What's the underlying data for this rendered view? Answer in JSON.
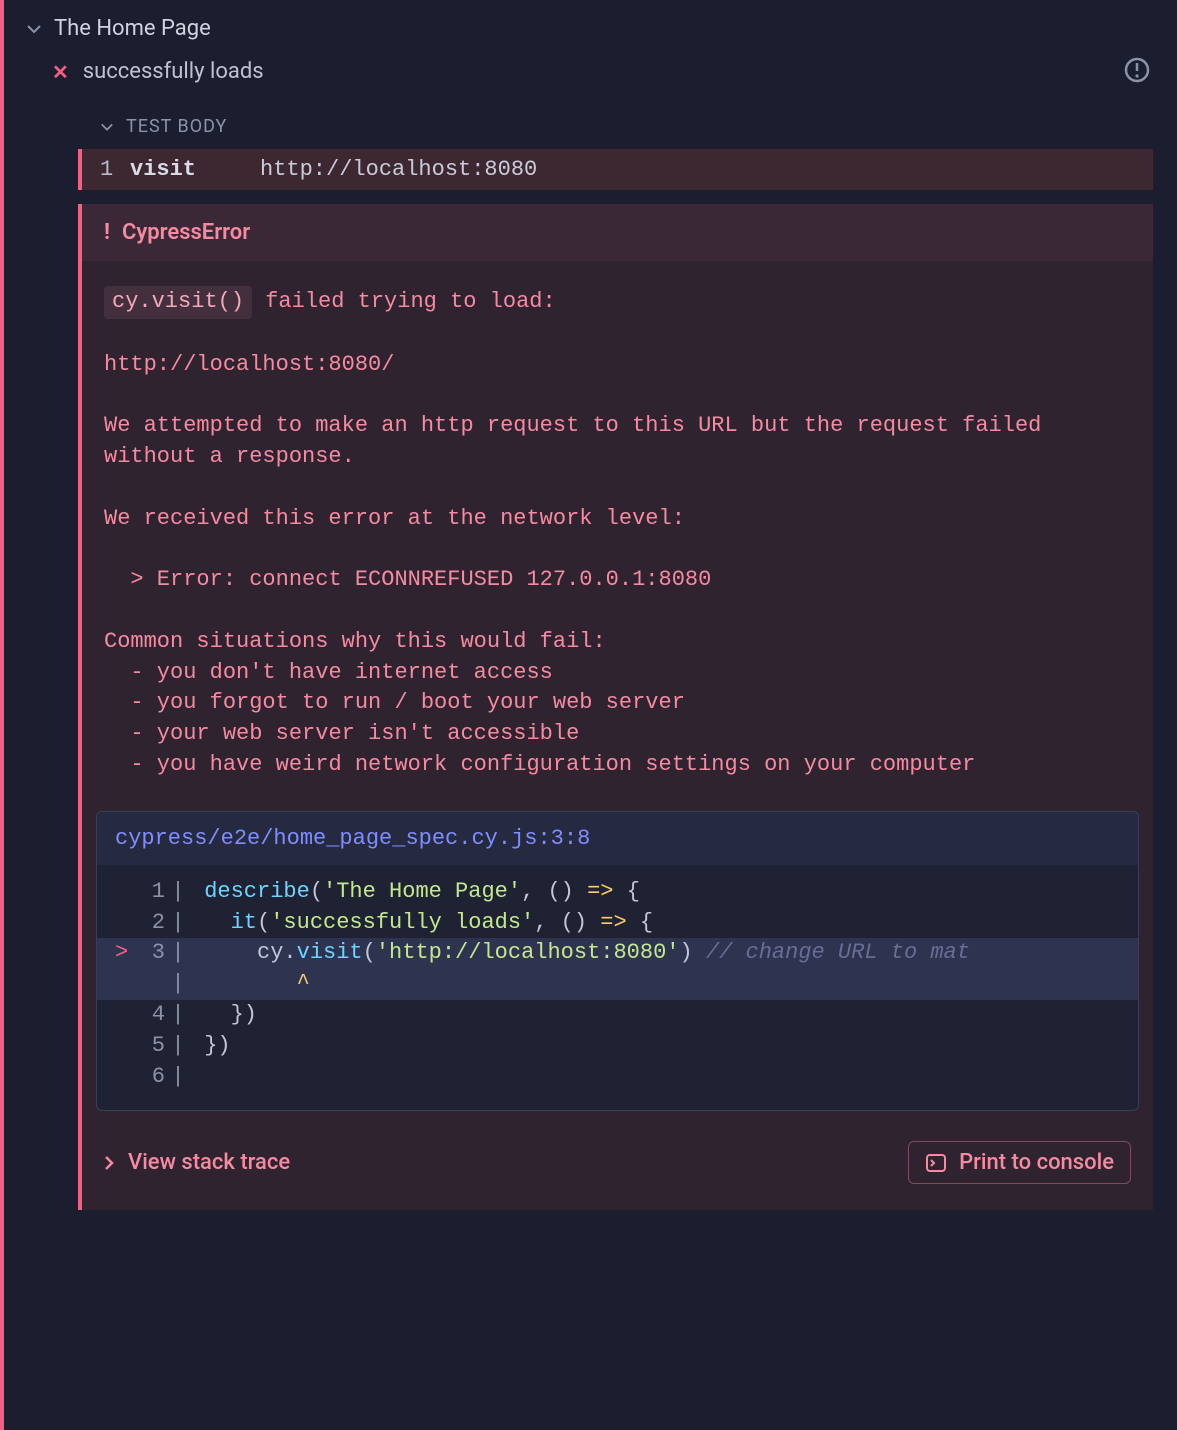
{
  "suite": {
    "title": "The Home Page"
  },
  "test": {
    "title": "successfully loads",
    "status": "failed"
  },
  "testBody": {
    "label": "TEST BODY"
  },
  "command": {
    "index": "1",
    "name": "visit",
    "arg": "http://localhost:8080"
  },
  "error": {
    "name": "CypressError",
    "chip": "cy.visit()",
    "chip_after": " failed trying to load:",
    "url": "http://localhost:8080/",
    "msg1": "We attempted to make an http request to this URL but the request failed without a response.",
    "msg2": "We received this error at the network level:",
    "netErr": "  > Error: connect ECONNREFUSED 127.0.0.1:8080",
    "msg3": "Common situations why this would fail:",
    "bullets": [
      "  - you don't have internet access",
      "  - you forgot to run / boot your web server",
      "  - your web server isn't accessible",
      "  - you have weird network configuration settings on your computer"
    ]
  },
  "codeFrame": {
    "location": "cypress/e2e/home_page_spec.cy.js:3:8",
    "lines": [
      {
        "mark": " ",
        "num": "1",
        "tokens": [
          {
            "cls": "tk-fn",
            "t": "describe"
          },
          {
            "cls": "tk-pn",
            "t": "("
          },
          {
            "cls": "tk-str",
            "t": "'The Home Page'"
          },
          {
            "cls": "tk-pn",
            "t": ", () "
          },
          {
            "cls": "tk-op",
            "t": "=>"
          },
          {
            "cls": "tk-pn",
            "t": " {"
          }
        ]
      },
      {
        "mark": " ",
        "num": "2",
        "tokens": [
          {
            "cls": "tk-pn",
            "t": "  "
          },
          {
            "cls": "tk-fn",
            "t": "it"
          },
          {
            "cls": "tk-pn",
            "t": "("
          },
          {
            "cls": "tk-str",
            "t": "'successfully loads'"
          },
          {
            "cls": "tk-pn",
            "t": ", () "
          },
          {
            "cls": "tk-op",
            "t": "=>"
          },
          {
            "cls": "tk-pn",
            "t": " {"
          }
        ]
      },
      {
        "mark": ">",
        "num": "3",
        "hl": true,
        "tokens": [
          {
            "cls": "tk-pn",
            "t": "    cy."
          },
          {
            "cls": "tk-fn",
            "t": "visit"
          },
          {
            "cls": "tk-pn",
            "t": "("
          },
          {
            "cls": "tk-str",
            "t": "'http://localhost:8080'"
          },
          {
            "cls": "tk-pn",
            "t": ") "
          },
          {
            "cls": "tk-cm",
            "t": "// change URL to mat"
          }
        ]
      },
      {
        "mark": " ",
        "num": " ",
        "hl": true,
        "tokens": [
          {
            "cls": "tk-caret",
            "t": "       ^"
          }
        ]
      },
      {
        "mark": " ",
        "num": "4",
        "tokens": [
          {
            "cls": "tk-pn",
            "t": "  })"
          }
        ]
      },
      {
        "mark": " ",
        "num": "5",
        "tokens": [
          {
            "cls": "tk-pn",
            "t": "})"
          }
        ]
      },
      {
        "mark": " ",
        "num": "6",
        "tokens": [
          {
            "cls": "tk-pn",
            "t": ""
          }
        ]
      }
    ]
  },
  "footer": {
    "stack": "View stack trace",
    "print": "Print to console"
  }
}
